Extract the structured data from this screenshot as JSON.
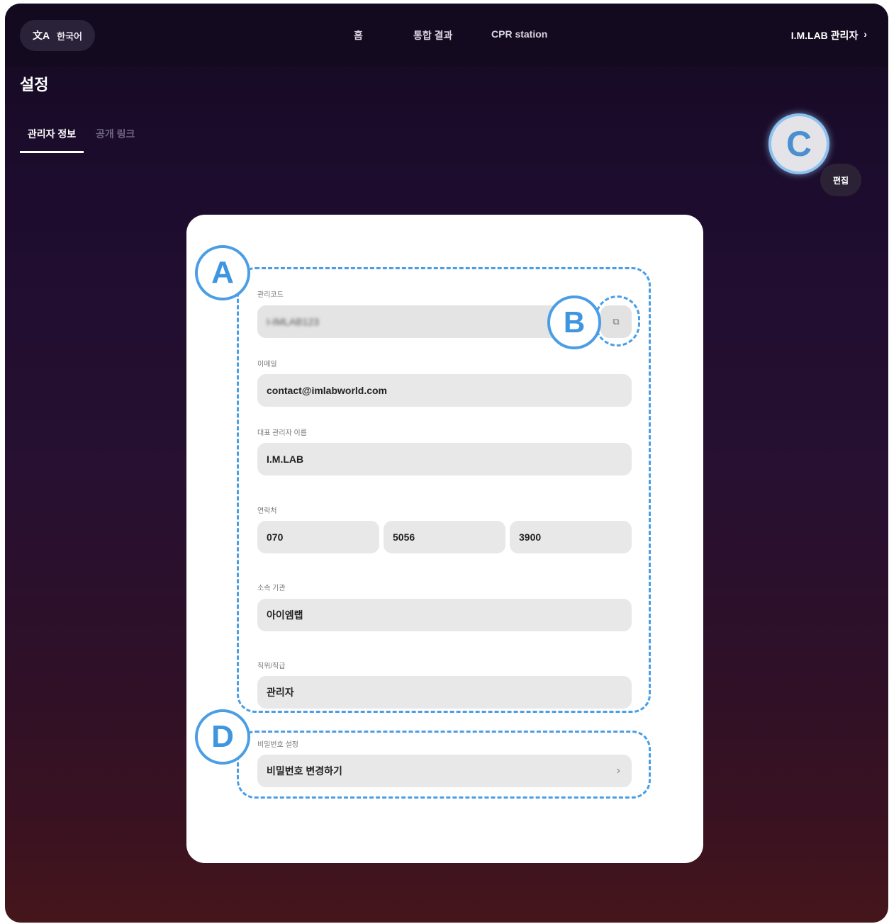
{
  "topbar": {
    "language_label": "한국어",
    "nav": [
      "홈",
      "통합 결과",
      "CPR station"
    ],
    "account_label": "I.M.LAB 관리자",
    "account_chevron": "›"
  },
  "page": {
    "title": "설정",
    "tabs": [
      "관리자 정보",
      "공개 링크"
    ],
    "edit_label": "편집"
  },
  "form": {
    "admin_code": {
      "label": "관리코드",
      "value": "I-IMLAB123"
    },
    "email": {
      "label": "이메일",
      "value": "contact@imlabworld.com"
    },
    "representative_name": {
      "label": "대표 관리자 이름",
      "value": "I.M.LAB"
    },
    "phone": {
      "label": "연락처",
      "parts": [
        "070",
        "5056",
        "3900"
      ]
    },
    "organization": {
      "label": "소속 기관",
      "value": "아이엠랩"
    },
    "role": {
      "label": "직위/직급",
      "value": "관리자"
    },
    "password": {
      "section_label": "비밀번호 설정",
      "change_label": "비밀번호 변경하기"
    }
  },
  "annotations": {
    "a": "A",
    "b": "B",
    "c": "C",
    "d": "D"
  },
  "colors": {
    "annotation": "#4a9ee6",
    "background_top": "#150a22",
    "background_bottom": "#45161c"
  },
  "icons": {
    "language": "translate-icon",
    "copy": "copy-icon",
    "chevron": "chevron-right-icon"
  }
}
